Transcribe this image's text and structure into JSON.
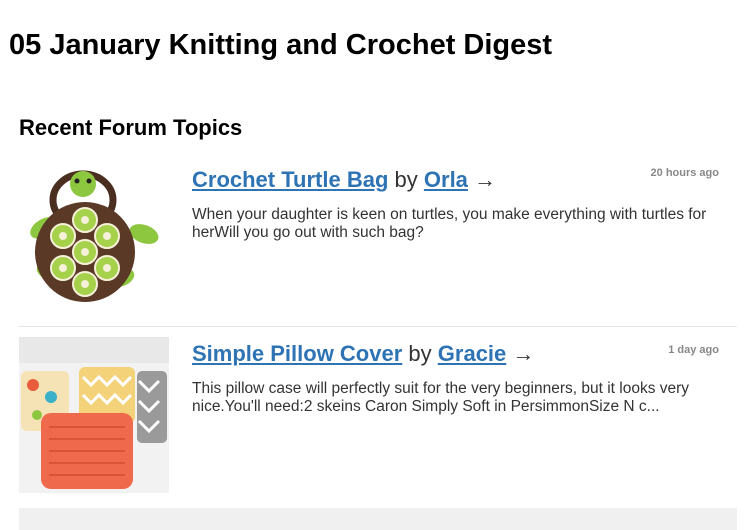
{
  "digest": {
    "title": "05 January Knitting and Crochet Digest"
  },
  "section": {
    "heading": "Recent Forum Topics"
  },
  "topics": [
    {
      "title": "Crochet Turtle Bag",
      "by": "by",
      "author": "Orla",
      "arrow": "→",
      "time": "20 hours ago",
      "excerpt": "When your daughter is keen on turtles, you make everything with turtles for herWill you go out with such bag?",
      "image": "crochet-turtle-bag-photo"
    },
    {
      "title": "Simple Pillow Cover",
      "by": "by",
      "author": "Gracie",
      "arrow": "→",
      "time": "1 day ago",
      "excerpt": "This pillow case will perfectly suit for the very beginners, but it looks very nice.You'll need:2 skeins Caron Simply Soft in PersimmonSize N c...",
      "image": "pillow-cover-photo"
    }
  ],
  "colors": {
    "link": "#2e74b5",
    "text": "#333333",
    "muted": "#888888",
    "divider": "#e6e6e6"
  }
}
